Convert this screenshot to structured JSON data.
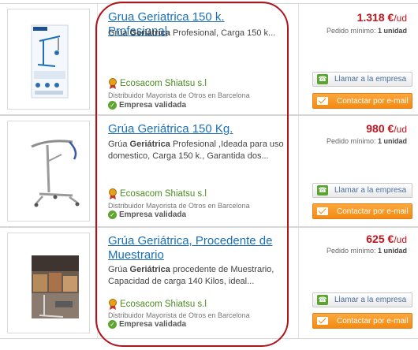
{
  "listings": [
    {
      "title": "Grua Geriatrica 150 k. Profesional",
      "description": [
        "Grúa ",
        "Geriátrica",
        " Profesional, Carga 150 k..."
      ],
      "company": "Ecosacom Shiatsu s.l",
      "distributor": "Distribuidor Mayorista de Otros en Barcelona",
      "validated": "Empresa validada",
      "price": "1.318 €",
      "price_unit": "/ud",
      "min_order_label": "Pedido mínimo: ",
      "min_order_value": "1 unidad",
      "call_label": "Llamar a la empresa",
      "mail_label": "Contactar por e-mail",
      "image": "brochure-crane"
    },
    {
      "title": "Grúa Geriátrica 150 Kg.",
      "description": [
        "Grúa ",
        "Geriátrica",
        " Profesional ,Ideada para uso domestico, Carga 150 k., Garantida dos..."
      ],
      "company": "Ecosacom Shiatsu s.l",
      "distributor": "Distribuidor Mayorista de Otros en Barcelona",
      "validated": "Empresa validada",
      "price": "980 €",
      "price_unit": "/ud",
      "min_order_label": "Pedido mínimo: ",
      "min_order_value": "1 unidad",
      "call_label": "Llamar a la empresa",
      "mail_label": "Contactar por e-mail",
      "image": "white-crane"
    },
    {
      "title": "Grúa Geriátrica, Procedente de Muestrario",
      "description": [
        "Grúa ",
        "Geriátrica",
        " procedente de Muestrario, Capacidad de carga 140 Kilos, ideal..."
      ],
      "company": "Ecosacom Shiatsu s.l",
      "distributor": "Distribuidor Mayorista de Otros en Barcelona",
      "validated": "Empresa validada",
      "price": "625 €",
      "price_unit": "/ud",
      "min_order_label": "Pedido mínimo: ",
      "min_order_value": "1 unidad",
      "call_label": "Llamar a la empresa",
      "mail_label": "Contactar por e-mail",
      "image": "showroom-photo"
    }
  ],
  "colors": {
    "title_link": "#1a6fb8",
    "price": "#c0141c",
    "company": "#4b8c1f",
    "mail_button": "#f48a12",
    "highlight": "#b0141c"
  }
}
